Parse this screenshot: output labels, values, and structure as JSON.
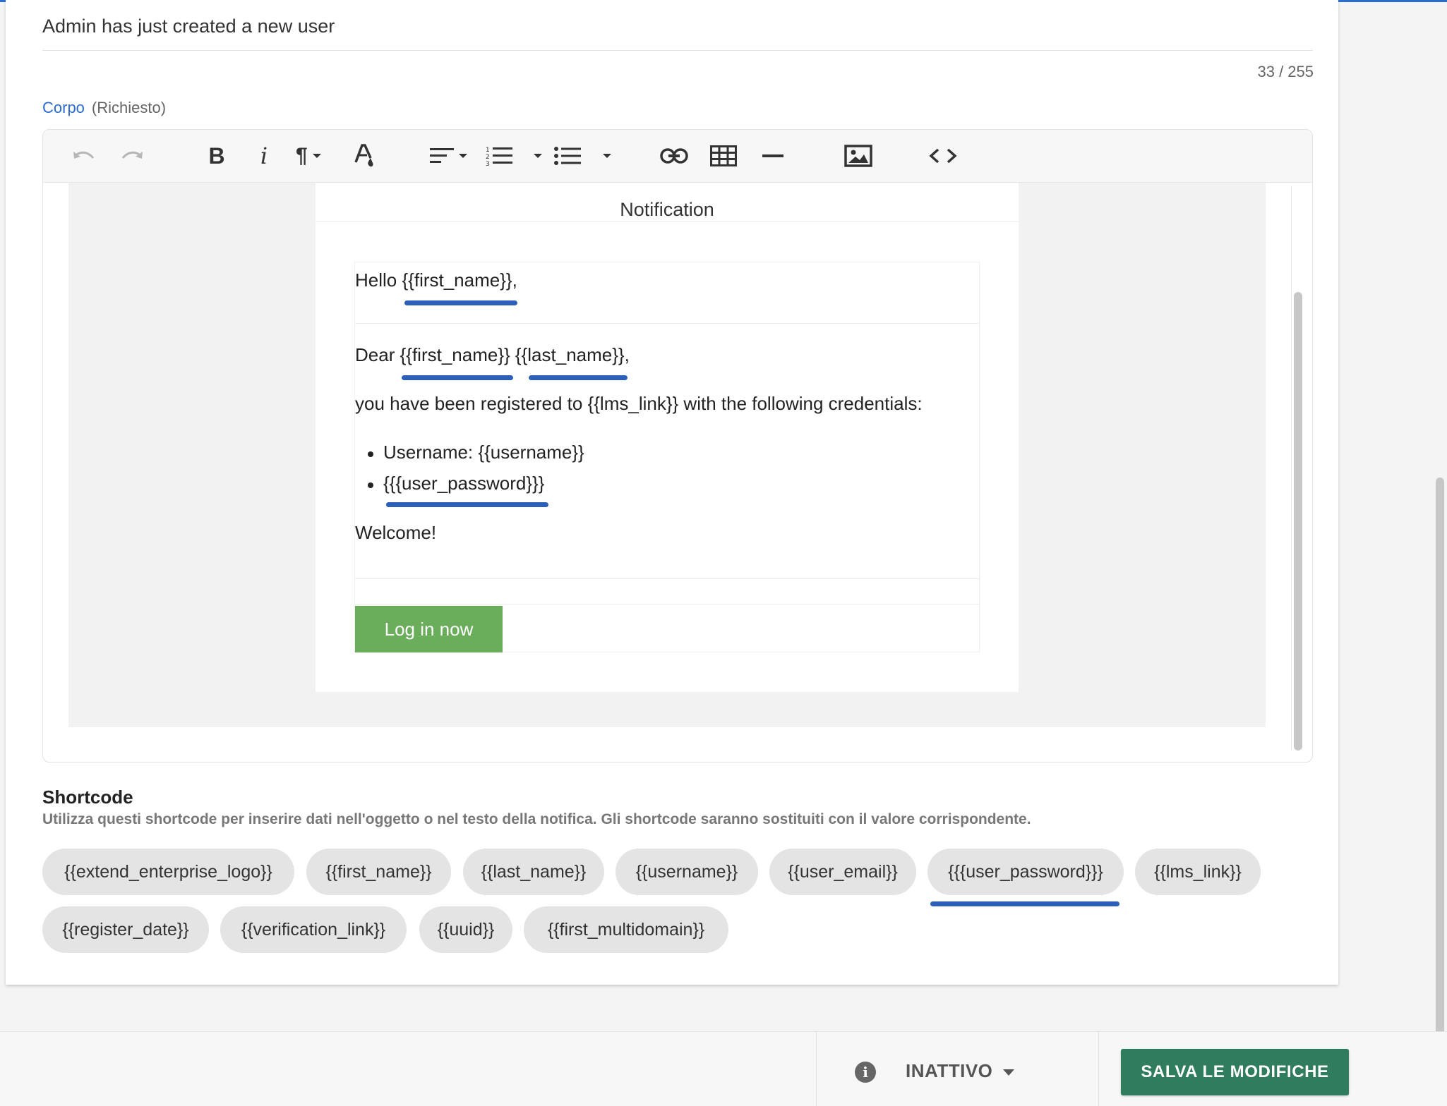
{
  "subject": {
    "value": "Admin has just created a new user",
    "counter": "33 / 255"
  },
  "body_field": {
    "label": "Corpo",
    "required": "(Richiesto)"
  },
  "toolbar": {
    "buttons": [
      "undo-icon",
      "redo-icon",
      "bold-icon",
      "italic-icon",
      "paragraph-icon",
      "text-color-icon",
      "align-icon",
      "ordered-list-icon",
      "unordered-list-icon",
      "link-icon",
      "table-icon",
      "horizontal-rule-icon",
      "image-icon",
      "code-view-icon"
    ],
    "bold_glyph": "B",
    "italic_glyph": "i",
    "paragraph_glyph": "¶"
  },
  "email": {
    "header": "Notification",
    "greeting": "Hello {{first_name}},",
    "dear_line": "Dear {{first_name}} {{last_name}},",
    "registered_line": "you have been registered to {{lms_link}} with the following credentials:",
    "bullets": [
      "Username: {{username}}",
      "{{{user_password}}}"
    ],
    "welcome": "Welcome!",
    "button": "Log in now"
  },
  "shortcode": {
    "title": "Shortcode",
    "description": "Utilizza questi shortcode per inserire dati nell'oggetto o nel testo della notifica. Gli shortcode saranno sostituiti con il valore corrispondente.",
    "chips": [
      "{{extend_enterprise_logo}}",
      "{{first_name}}",
      "{{last_name}}",
      "{{username}}",
      "{{user_email}}",
      "{{{user_password}}}",
      "{{lms_link}}",
      "{{register_date}}",
      "{{verification_link}}",
      "{{uuid}}",
      "{{first_multidomain}}"
    ]
  },
  "footer": {
    "info_glyph": "i",
    "status": "INATTIVO",
    "save_button": "SALVA LE MODIFICHE"
  },
  "colors": {
    "accent": "#2b6ccf",
    "annotation": "#2b5fb8",
    "login_button": "#6aad5b",
    "save_button": "#2f7d5c"
  }
}
